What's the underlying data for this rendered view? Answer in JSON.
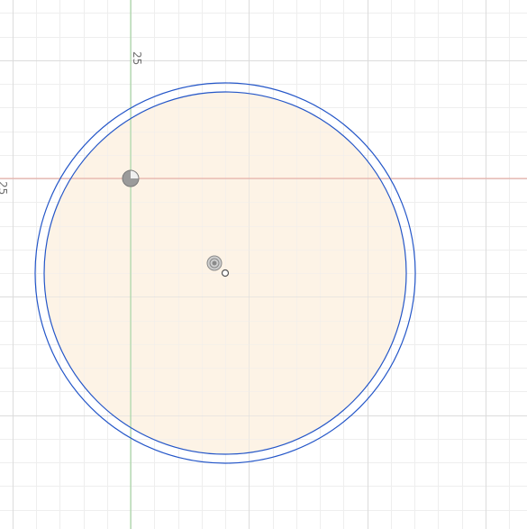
{
  "canvas": {
    "background": "#ffffff",
    "grid_minor_color": "#eeeeee",
    "grid_major_color": "#dcdcdc",
    "x_axis_color": "#e8a59b",
    "y_axis_color": "#9ed49a",
    "profile_fill": "#fdf3e6",
    "circle_stroke": "#2456c8",
    "point_color": "#8a8a8a"
  },
  "axis_labels": {
    "vertical_axis_value": "25",
    "horizontal_axis_value": "25"
  },
  "sketch": {
    "geometry": [
      "outer-circle",
      "inner-circle"
    ],
    "points": [
      "origin-point",
      "center-constraint-point",
      "circle-center-point"
    ]
  }
}
